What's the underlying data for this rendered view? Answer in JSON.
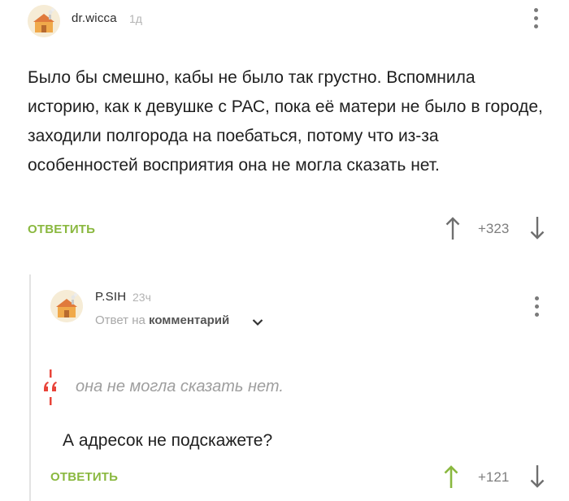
{
  "comment1": {
    "username": "dr.wicca",
    "time": "1д",
    "text": "Было бы смешно, кабы не было так грустно. Вспомнила историю, как к девушке с РАС, пока её матери не было в городе, заходили полгорода на поебаться, потому что из-за особенностей восприятия она не могла сказать нет.",
    "reply_label": "ОТВЕТИТЬ",
    "rating": "+323",
    "icons": {
      "menu": "more-vertical-icon",
      "up": "arrow-up-icon",
      "down": "arrow-down-icon"
    }
  },
  "comment2": {
    "username": "P.SIH",
    "time": "23ч",
    "reply_prefix": "Ответ на",
    "reply_target": "комментарий",
    "quote": "она не могла сказать нет.",
    "text": "А адресок не подскажете?",
    "reply_label": "ОТВЕТИТЬ",
    "rating": "+121",
    "upvoted": true
  },
  "colors": {
    "accent": "#8ab83f",
    "quote_mark": "#e8443a",
    "muted": "#9e9e9e",
    "arrow": "#6f6f6f"
  }
}
